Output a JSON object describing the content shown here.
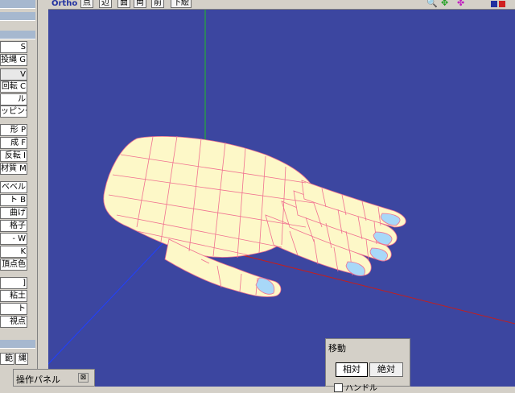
{
  "toolbar": {
    "view_mode": "Ortho",
    "buttons": [
      "点",
      "辺",
      "面",
      "両",
      "前",
      "下絵"
    ],
    "icons": [
      "magnify-icon",
      "move-view-icon",
      "rotate-view-icon"
    ]
  },
  "sidebar": {
    "tools": [
      "S",
      "投縄 G",
      "V",
      "回転 C",
      "ル",
      "ッピング",
      "形 P",
      "成 F",
      "反転 I",
      "材質 M",
      "ベベル",
      "ト B",
      "曲げ",
      "格子",
      "- W",
      "K",
      "頂点色",
      "]",
      "粘土",
      "ト",
      "視点",
      "範",
      "縄"
    ]
  },
  "move_panel": {
    "title": "移動",
    "relative": "相対",
    "absolute": "絶対",
    "check_label": "ハンドル"
  },
  "operation_panel": {
    "title": "操作パネル",
    "close": "⊠"
  },
  "colors": {
    "viewport_bg": "#3c46a0",
    "mesh_fill": "#fdf8c8",
    "mesh_wire": "#f07090",
    "selected_face": "#a8d8f8",
    "axis_x": "#e02020",
    "axis_y": "#20c020",
    "axis_z": "#2040ff"
  }
}
